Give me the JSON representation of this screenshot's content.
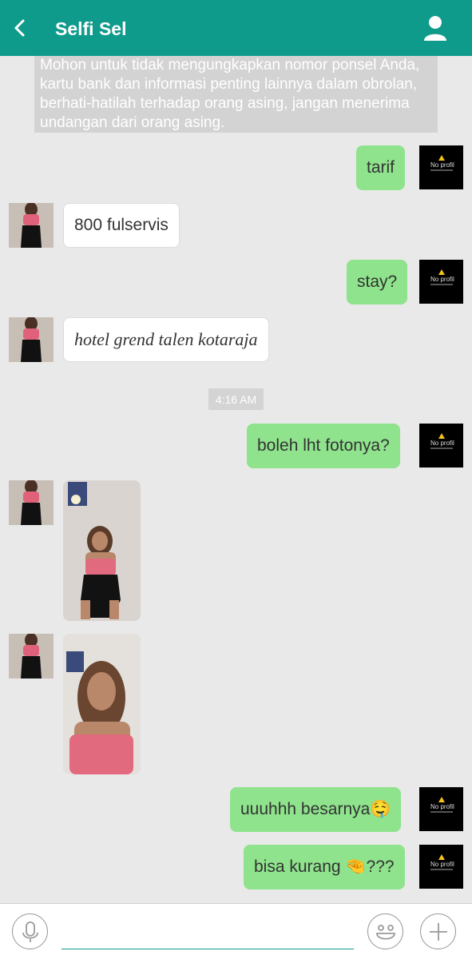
{
  "header": {
    "title": "Selfi Sel",
    "back_icon": "chevron-left-icon",
    "profile_icon": "user-icon",
    "color": "#0e9b8b"
  },
  "notice": {
    "text": "Mohon untuk tidak  mengungkapkan nomor ponsel Anda, kartu bank dan informasi penting lainnya dalam obrolan, berhati-hatilah terhadap orang asing, jangan menerima undangan dari orang asing."
  },
  "my_avatar": {
    "label": "No profil"
  },
  "messages": {
    "m1": "tarif",
    "m2": "800 fulservis",
    "m3": "stay?",
    "m4": "hotel grend talen kotaraja",
    "m5": "boleh lht fotonya?",
    "m8": "uuuhhh besarnya🤤",
    "m9": "bisa kurang 🤏???"
  },
  "timestamp": "4:16 AM",
  "input": {
    "placeholder": ""
  },
  "colors": {
    "outgoing": "#8ee38c",
    "incoming": "#ffffff",
    "background": "#e9e9e9"
  }
}
